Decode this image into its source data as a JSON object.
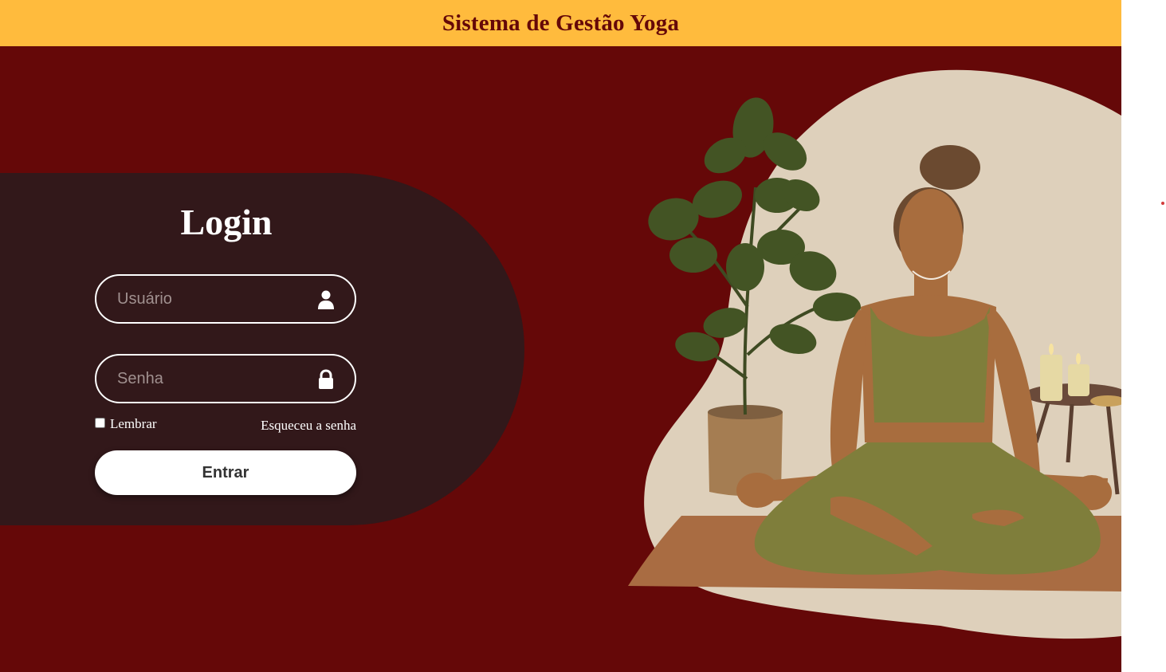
{
  "header": {
    "title": "Sistema de Gestão Yoga"
  },
  "login": {
    "title": "Login",
    "username": {
      "placeholder": "Usuário",
      "value": "",
      "icon": "user-icon"
    },
    "password": {
      "placeholder": "Senha",
      "value": "",
      "icon": "lock-icon"
    },
    "remember_label": "Lembrar",
    "remember_checked": false,
    "forgot_label": "Esqueceu a senha",
    "submit_label": "Entrar"
  },
  "colors": {
    "header_bg": "#ffbb3d",
    "header_text": "#650808",
    "page_bg": "#650808",
    "panel_bg": "#32181a",
    "button_bg": "#ffffff"
  }
}
